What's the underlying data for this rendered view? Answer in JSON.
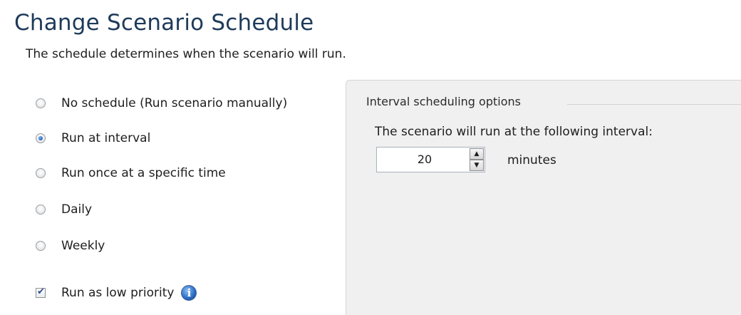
{
  "header": {
    "title": "Change Scenario Schedule",
    "subtitle": "The schedule determines when the scenario will run."
  },
  "schedule_options": [
    {
      "label": "No schedule (Run scenario manually)",
      "selected": false
    },
    {
      "label": "Run at interval",
      "selected": true
    },
    {
      "label": "Run once at a specific time",
      "selected": false
    },
    {
      "label": "Daily",
      "selected": false
    },
    {
      "label": "Weekly",
      "selected": false
    }
  ],
  "low_priority": {
    "label": "Run as low priority",
    "checked": true,
    "info_icon": "info-icon"
  },
  "interval_panel": {
    "group_title": "Interval scheduling options",
    "description": "The scenario will run at the following interval:",
    "value": "20",
    "units": "minutes"
  },
  "icons": {
    "spin_up": "▲",
    "spin_down": "▼",
    "checkmark": "✔",
    "info": "i"
  },
  "colors": {
    "title": "#1e3a5a",
    "panel_background": "#f0f0f0",
    "radio_selected": "#2b6fc7",
    "info_icon": "#2f6fc6"
  }
}
